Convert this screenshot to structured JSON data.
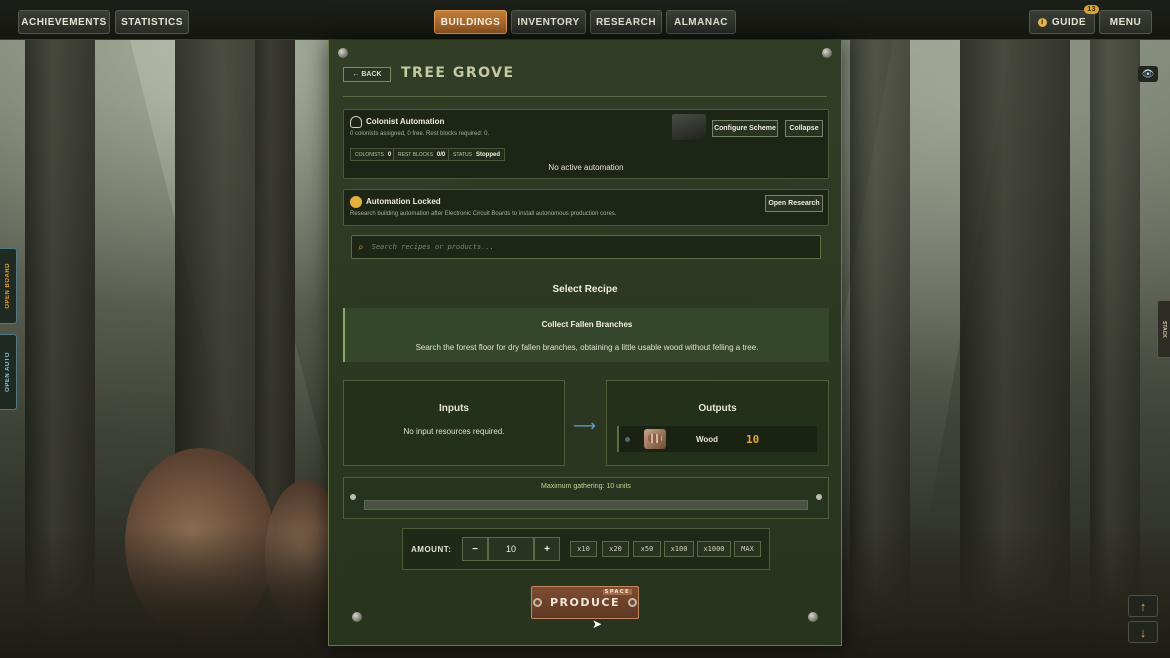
{
  "topbar": {
    "left": [
      "ACHIEVEMENTS",
      "STATISTICS"
    ],
    "tabs": [
      "BUILDINGS",
      "INVENTORY",
      "RESEARCH",
      "ALMANAC"
    ],
    "active_tab": "BUILDINGS",
    "guide_label": "GUIDE",
    "guide_badge": "13",
    "menu_label": "MENU"
  },
  "sidetabs": {
    "board": "OPEN BOARD",
    "auto": "OPEN AUTO",
    "right": "STACK"
  },
  "panel": {
    "back_label": "← BACK",
    "title": "TREE GROVE",
    "automation": {
      "title": "Colonist Automation",
      "subtitle": "0 colonists assigned, 0 free. Rest blocks required: 0.",
      "colonists_label": "COLONISTS",
      "colonists_value": "0",
      "rest_label": "REST BLOCKS",
      "rest_value": "0/0",
      "status_label": "STATUS",
      "status_value": "Stopped",
      "configure_label": "Configure Scheme",
      "collapse_label": "Collapse",
      "empty_text": "No active automation"
    },
    "locked": {
      "title": "Automation Locked",
      "desc": "Research building automation after Electronic Circuit Boards to install autonomous production cores.",
      "button_label": "Open Research"
    },
    "search": {
      "placeholder": "Search recipes or products..."
    },
    "select_heading": "Select Recipe",
    "recipe": {
      "name": "Collect Fallen Branches",
      "desc": "Search the forest floor for dry fallen branches, obtaining a little usable wood without felling a tree."
    },
    "inputs": {
      "title": "Inputs",
      "empty": "No input resources required."
    },
    "outputs": {
      "title": "Outputs",
      "items": [
        {
          "name": "Wood",
          "qty": "10"
        }
      ]
    },
    "gather": {
      "label": "Maximum gathering: 10 units"
    },
    "amount": {
      "label": "AMOUNT:",
      "value": "10",
      "minus": "−",
      "plus": "+",
      "multipliers": [
        "x10",
        "x20",
        "x50",
        "x100",
        "x1000",
        "MAX"
      ]
    },
    "produce": {
      "label": "PRODUCE",
      "hotkey": "SPACE"
    }
  },
  "colors": {
    "accent": "#c07d3a",
    "panel": "#2e3a22",
    "qty": "#e1a735"
  }
}
